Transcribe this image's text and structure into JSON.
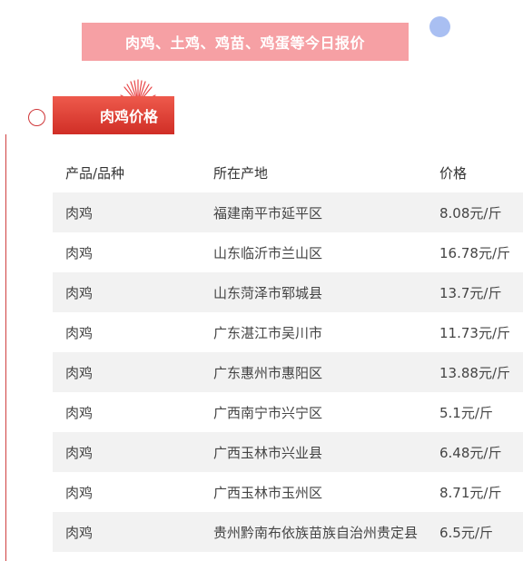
{
  "banner": {
    "title": "肉鸡、土鸡、鸡苗、鸡蛋等今日报价"
  },
  "section": {
    "title": "肉鸡价格"
  },
  "table": {
    "headers": [
      "产品/品种",
      "所在产地",
      "价格"
    ],
    "rows": [
      [
        "肉鸡",
        "福建南平市延平区",
        "8.08元/斤"
      ],
      [
        "肉鸡",
        "山东临沂市兰山区",
        "16.78元/斤"
      ],
      [
        "肉鸡",
        "山东菏泽市郓城县",
        "13.7元/斤"
      ],
      [
        "肉鸡",
        "广东湛江市吴川市",
        "11.73元/斤"
      ],
      [
        "肉鸡",
        "广东惠州市惠阳区",
        "13.88元/斤"
      ],
      [
        "肉鸡",
        "广西南宁市兴宁区",
        "5.1元/斤"
      ],
      [
        "肉鸡",
        "广西玉林市兴业县",
        "6.48元/斤"
      ],
      [
        "肉鸡",
        "广西玉林市玉州区",
        "8.71元/斤"
      ],
      [
        "肉鸡",
        "贵州黔南布依族苗族自治州贵定县",
        "6.5元/斤"
      ]
    ]
  },
  "colors": {
    "banner_bg": "#f6a0a4",
    "section_tab": "#d02e26",
    "accent_blue": "#a9bff2",
    "row_stripe": "#f2f2f2"
  }
}
